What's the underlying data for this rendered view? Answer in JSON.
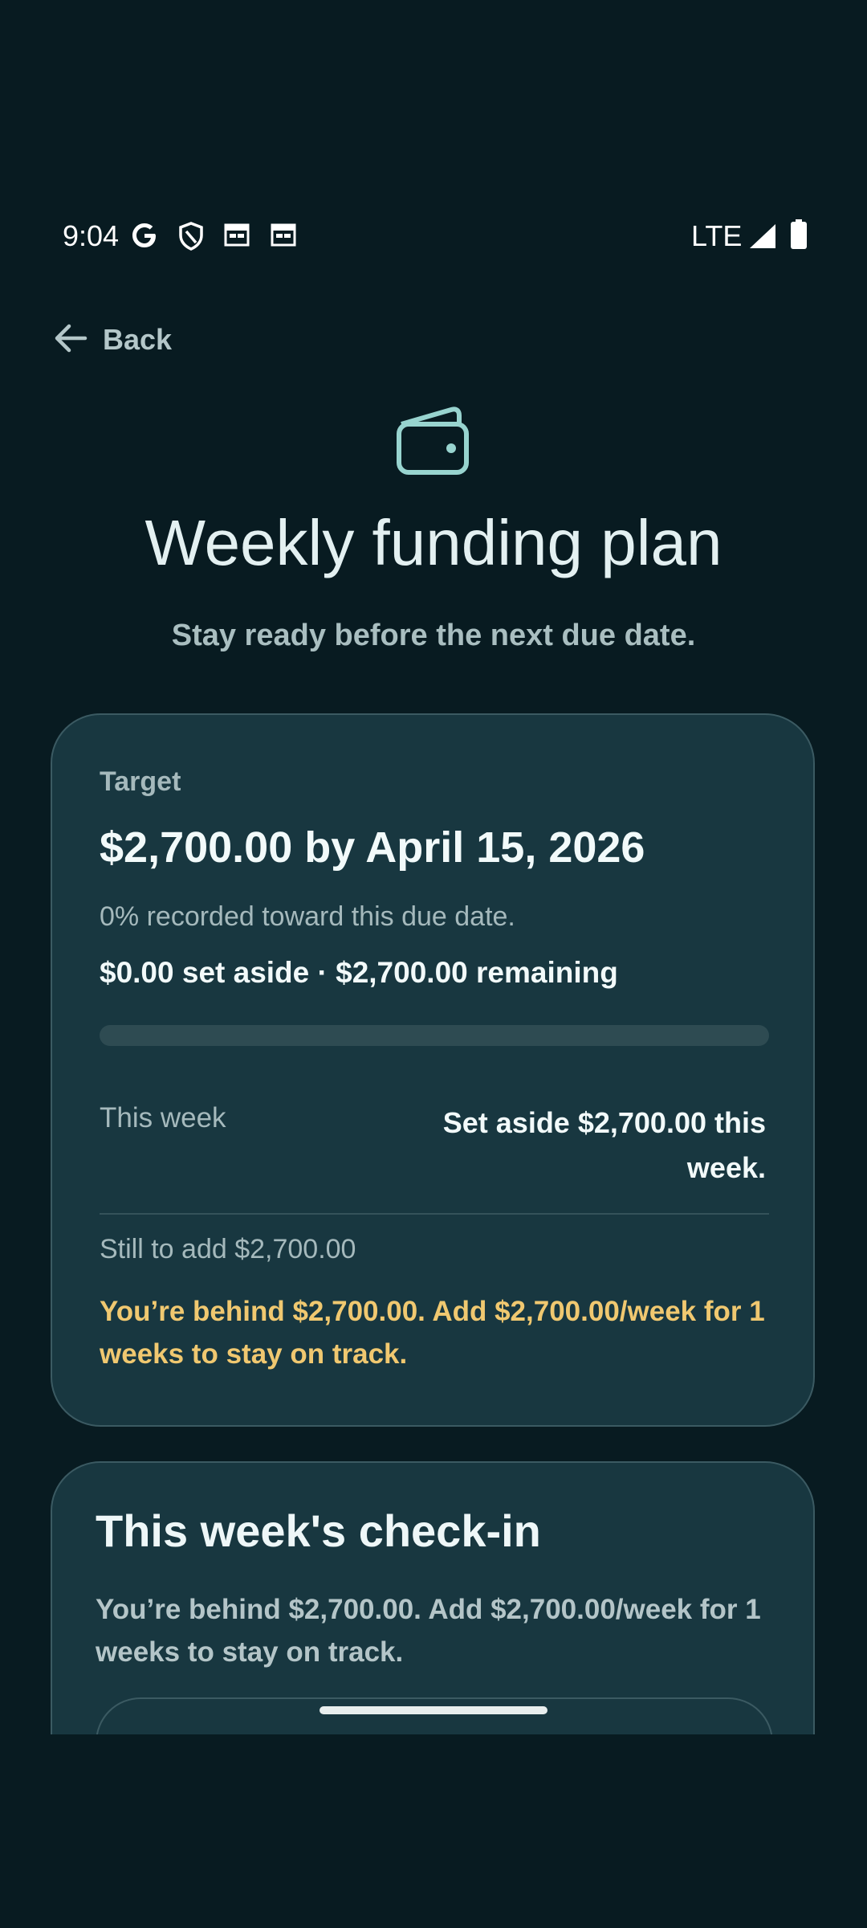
{
  "status_bar": {
    "time": "9:04",
    "network": "LTE",
    "icons": [
      "google-icon",
      "shield-icon",
      "calendar-icon",
      "calendar-icon",
      "signal-icon",
      "battery-icon"
    ]
  },
  "nav": {
    "back_label": "Back",
    "back_icon": "arrow-left-icon"
  },
  "header": {
    "icon": "wallet-icon",
    "title": "Weekly funding plan",
    "subtitle": "Stay ready before the next due date."
  },
  "target_card": {
    "label": "Target",
    "amount_date": "$2,700.00 by April 15, 2026",
    "recorded_text": "0% recorded toward this due date.",
    "summary": "$0.00 set aside · $2,700.00 remaining",
    "progress_fraction": 0.0,
    "this_week_label": "This week",
    "this_week_value": "Set aside $2,700.00 this week.",
    "still_to_add": "Still to add $2,700.00",
    "warning": "You’re behind $2,700.00. Add $2,700.00/week for 1 weeks to stay on track."
  },
  "checkin_card": {
    "title": "This week's check-in",
    "text": "You’re behind $2,700.00. Add $2,700.00/week for 1 weeks to stay on track."
  },
  "colors": {
    "background": "#081b21",
    "card": "#183740",
    "warning": "#f0c870",
    "accent": "#8fd4cf"
  }
}
